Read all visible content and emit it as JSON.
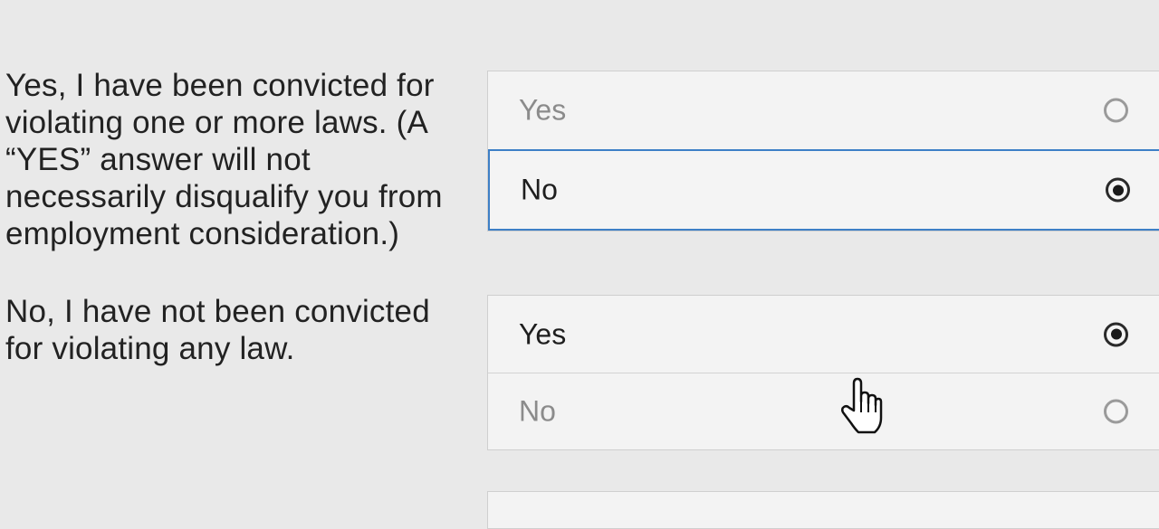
{
  "questions": [
    {
      "text": "Yes, I have been convicted for violating one or more laws. (A “YES” answer will not necessarily disqualify you from employment consideration.)",
      "options": [
        {
          "label": "Yes",
          "selected": false
        },
        {
          "label": "No",
          "selected": true,
          "focused": true
        }
      ]
    },
    {
      "text": "No, I have not been convicted for violating any law.",
      "options": [
        {
          "label": "Yes",
          "selected": true
        },
        {
          "label": "No",
          "selected": false
        }
      ]
    }
  ],
  "colors": {
    "focus_border": "#3d7fc6",
    "unselected_text": "#8b8b8b",
    "selected_text": "#1e1e1e"
  },
  "cursor": {
    "icon": "hand-pointer-icon"
  }
}
